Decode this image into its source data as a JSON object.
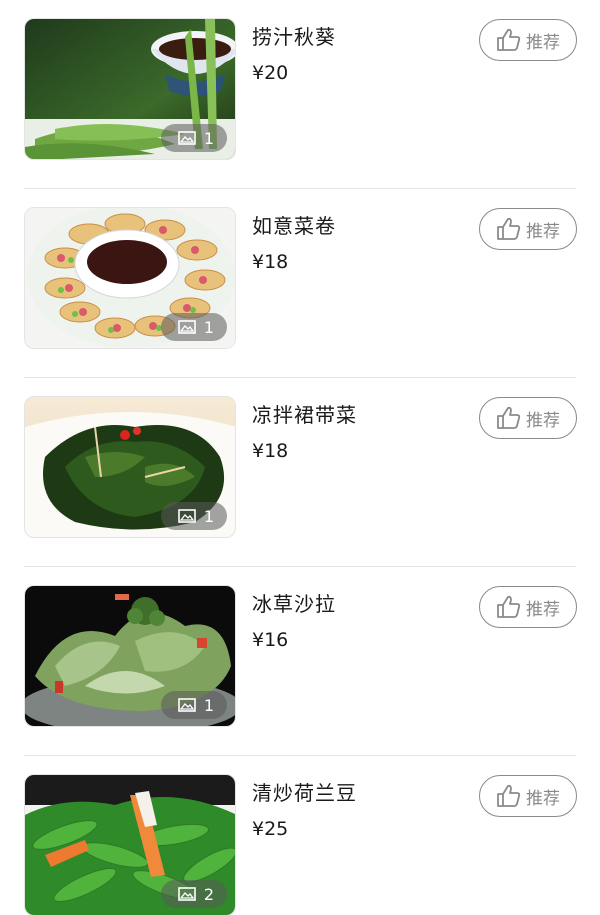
{
  "dishes": [
    {
      "name": "捞汁秋葵",
      "price": "¥20",
      "image_count": "1",
      "recommend_label": "推荐"
    },
    {
      "name": "如意菜卷",
      "price": "¥18",
      "image_count": "1",
      "recommend_label": "推荐"
    },
    {
      "name": "凉拌裙带菜",
      "price": "¥18",
      "image_count": "1",
      "recommend_label": "推荐"
    },
    {
      "name": "冰草沙拉",
      "price": "¥16",
      "image_count": "1",
      "recommend_label": "推荐"
    },
    {
      "name": "清炒荷兰豆",
      "price": "¥25",
      "image_count": "2",
      "recommend_label": "推荐"
    }
  ],
  "icons": {
    "image_count": "image-icon",
    "recommend": "thumbs-up-icon"
  },
  "colors": {
    "divider": "#e6e6e6",
    "button_outline": "#8a8a8a",
    "count_badge_bg": "rgba(90,90,90,0.55)"
  }
}
